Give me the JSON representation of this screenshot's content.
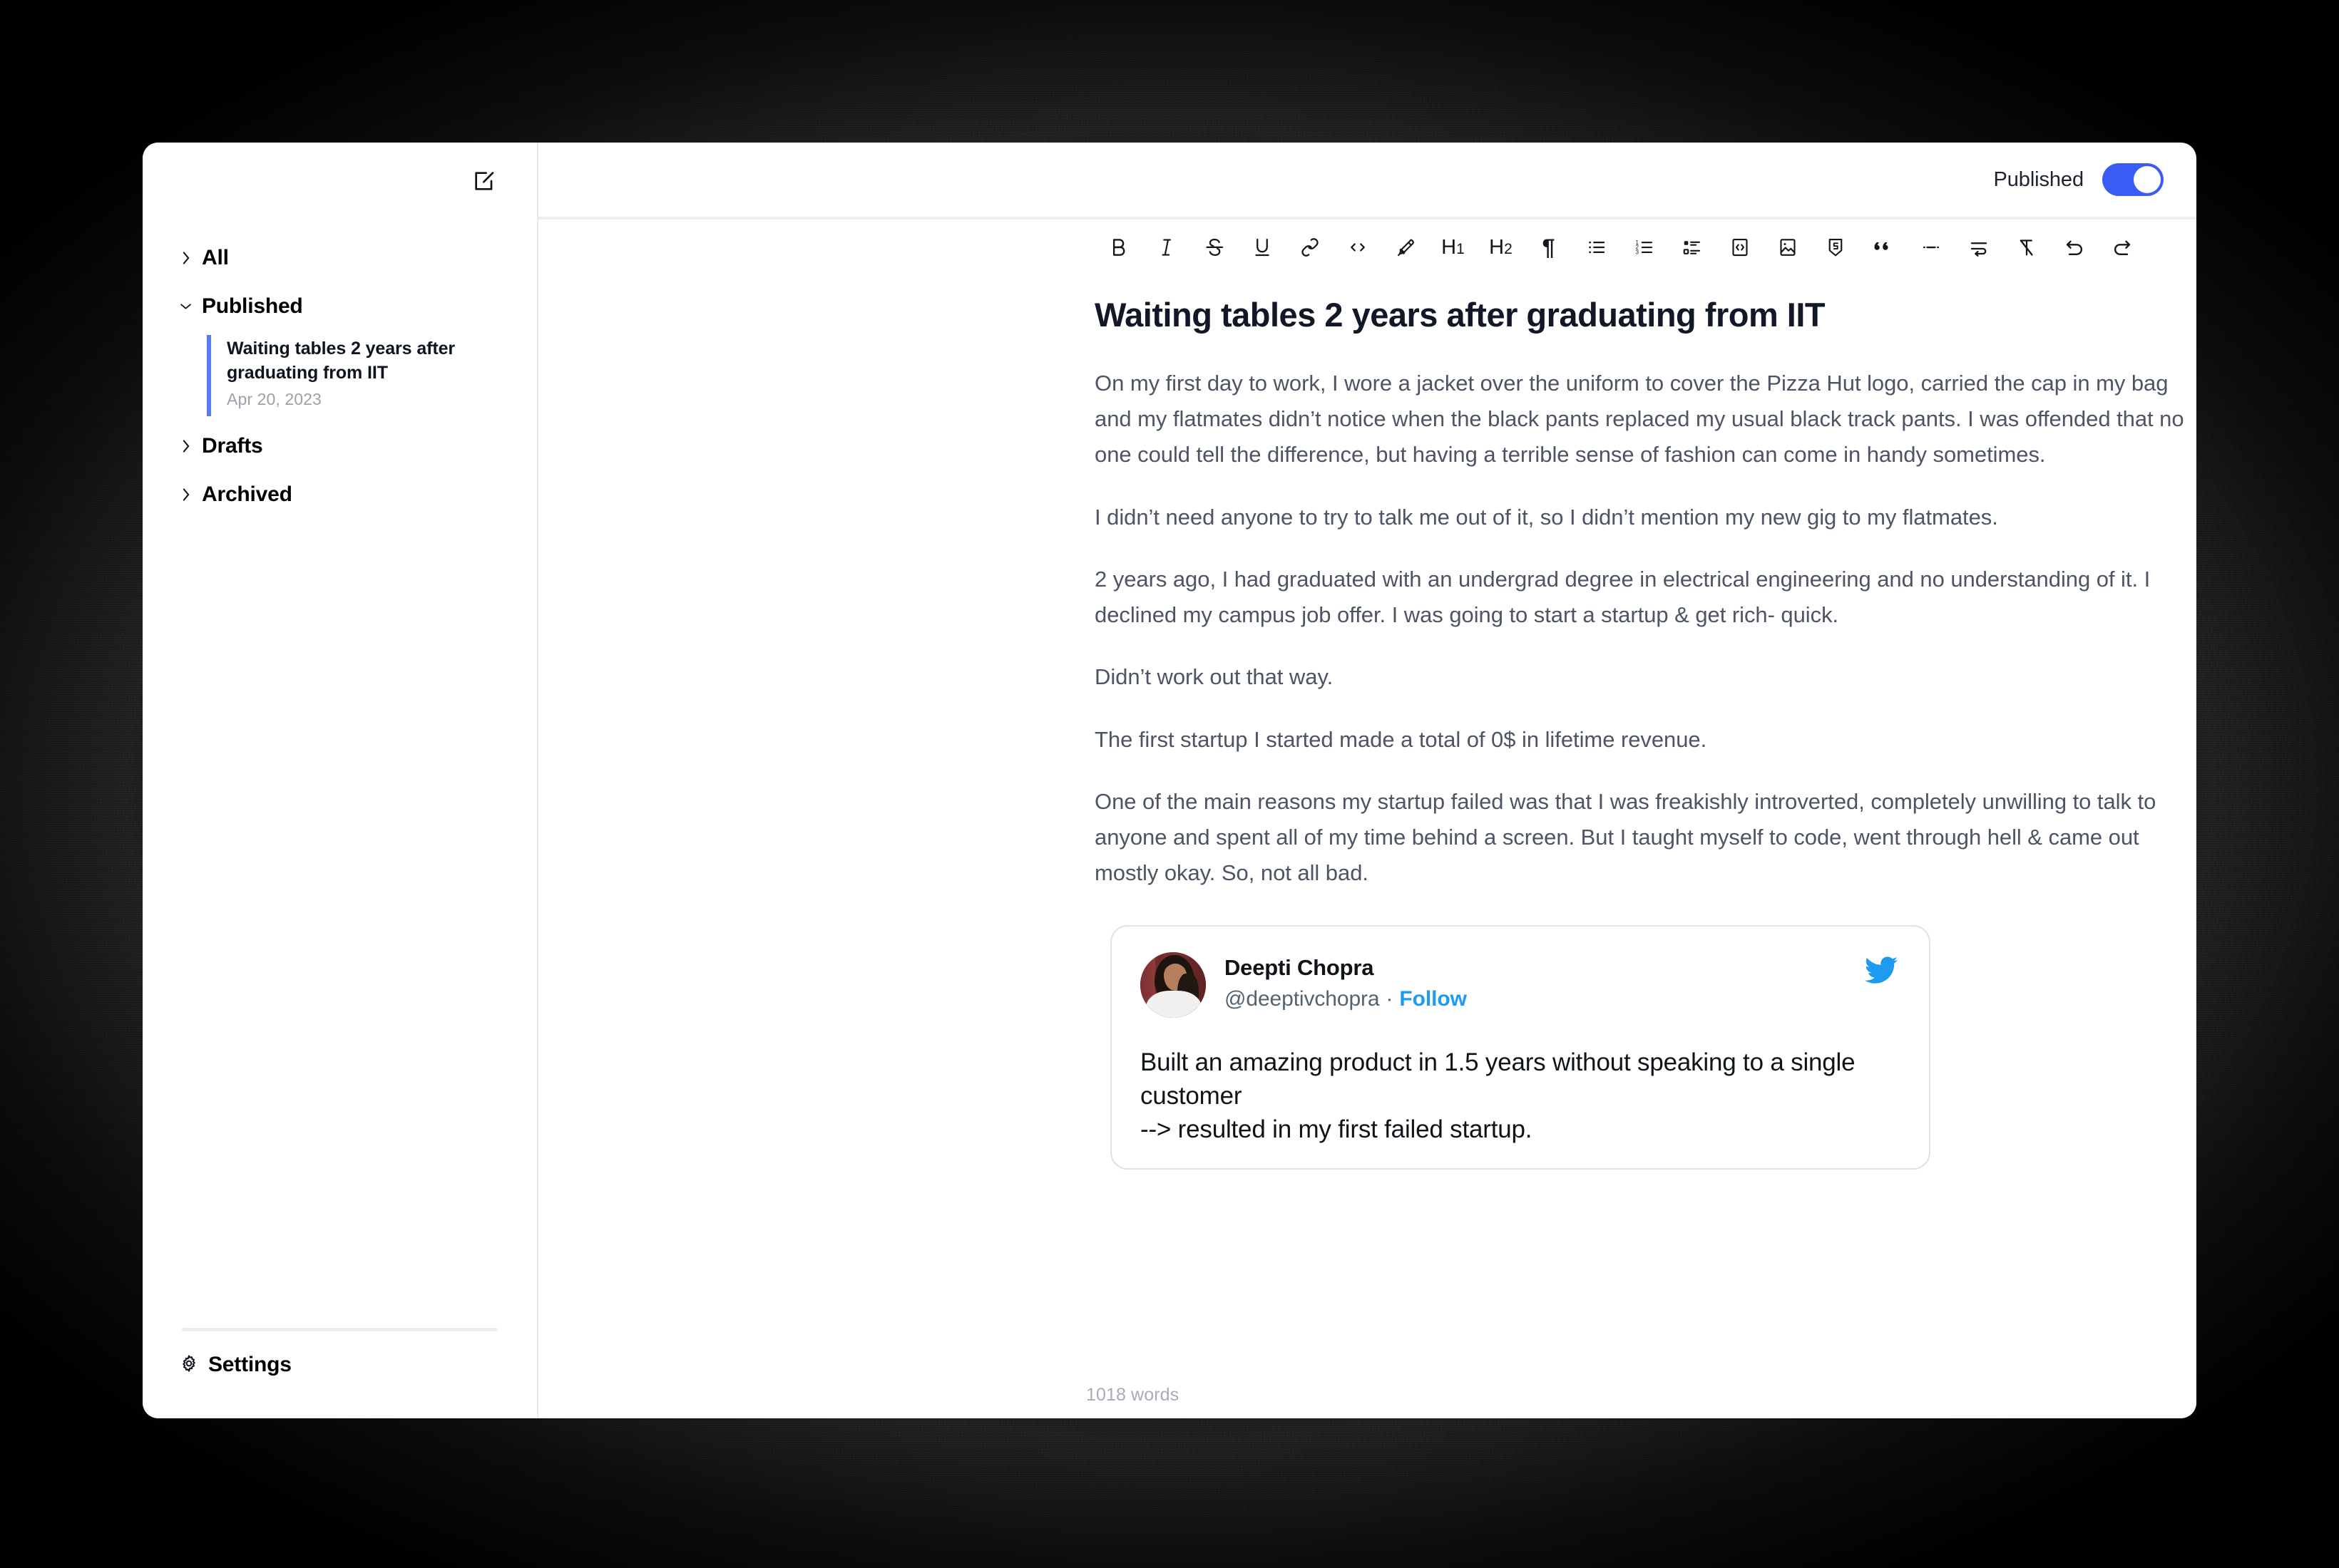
{
  "sidebar": {
    "compose_icon": "compose-note-icon",
    "groups": [
      {
        "label": "All",
        "icon": "chevron-right-icon",
        "expanded": false,
        "notes": []
      },
      {
        "label": "Published",
        "icon": "chevron-down-icon",
        "expanded": true,
        "notes": [
          {
            "title": "Waiting tables 2 years after graduating from IIT",
            "date": "Apr 20, 2023",
            "selected": true
          }
        ]
      },
      {
        "label": "Drafts",
        "icon": "chevron-right-icon",
        "expanded": false,
        "notes": []
      },
      {
        "label": "Archived",
        "icon": "chevron-right-icon",
        "expanded": false,
        "notes": []
      }
    ],
    "settings": {
      "label": "Settings",
      "icon": "gear-icon"
    }
  },
  "header": {
    "status_label": "Published",
    "toggle_on": true,
    "accent_color": "#3b5bf5"
  },
  "toolbar": {
    "items": [
      {
        "name": "bold",
        "icon": "bold-icon",
        "glyph": "B"
      },
      {
        "name": "italic",
        "icon": "italic-icon",
        "glyph": "I"
      },
      {
        "name": "strikethrough",
        "icon": "strikethrough-icon",
        "glyph": "S"
      },
      {
        "name": "underline",
        "icon": "underline-icon",
        "glyph": "U"
      },
      {
        "name": "link",
        "icon": "link-icon",
        "glyph": ""
      },
      {
        "name": "inline-code",
        "icon": "code-inline-icon",
        "glyph": ""
      },
      {
        "name": "highlight",
        "icon": "highlighter-icon",
        "glyph": ""
      },
      {
        "name": "heading-1",
        "icon": "h1-icon",
        "glyph": "H1"
      },
      {
        "name": "heading-2",
        "icon": "h2-icon",
        "glyph": "H2"
      },
      {
        "name": "paragraph",
        "icon": "pilcrow-icon",
        "glyph": "¶"
      },
      {
        "name": "bullet-list",
        "icon": "bullet-list-icon",
        "glyph": ""
      },
      {
        "name": "ordered-list",
        "icon": "ordered-list-icon",
        "glyph": ""
      },
      {
        "name": "task-list",
        "icon": "task-list-icon",
        "glyph": ""
      },
      {
        "name": "code-block",
        "icon": "code-block-icon",
        "glyph": ""
      },
      {
        "name": "image",
        "icon": "image-icon",
        "glyph": ""
      },
      {
        "name": "embed",
        "icon": "embed-badge-icon",
        "glyph": ""
      },
      {
        "name": "blockquote",
        "icon": "quote-icon",
        "glyph": ""
      },
      {
        "name": "horizontal-rule",
        "icon": "horizontal-rule-icon",
        "glyph": ""
      },
      {
        "name": "line-break",
        "icon": "line-break-icon",
        "glyph": ""
      },
      {
        "name": "clear-format",
        "icon": "clear-formatting-icon",
        "glyph": ""
      },
      {
        "name": "undo",
        "icon": "undo-icon",
        "glyph": ""
      },
      {
        "name": "redo",
        "icon": "redo-icon",
        "glyph": ""
      }
    ]
  },
  "document": {
    "title": "Waiting tables 2 years after graduating from IIT",
    "paragraphs": [
      "On my first day to work, I wore a jacket over the uniform to cover the Pizza Hut logo, carried the cap in my bag and my flatmates didn’t notice when the black pants replaced my usual black track pants. I was offended that no one could tell the difference, but having a terrible sense of fashion can come in handy sometimes.",
      "I didn’t need anyone to try to talk me out of it, so I didn’t mention my new gig to my flatmates.",
      "2 years ago, I had graduated with an undergrad degree in electrical engineering and no understanding of it. I declined my campus job offer. I was going to start a startup & get rich- quick.",
      "Didn’t work out that way.",
      "The first startup I started made a total of 0$ in lifetime revenue.",
      "One of the main reasons my startup failed was that I was freakishly introverted, completely unwilling to talk to anyone and spent all of my time behind a screen. But I taught myself to code, went through hell & came out mostly okay. So, not all bad."
    ],
    "tweet": {
      "author_name": "Deepti Chopra",
      "handle": "@deeptivchopra",
      "separator": "·",
      "follow_label": "Follow",
      "bird_icon": "twitter-bird-icon",
      "bird_color": "#1d9bf0",
      "text": "Built an amazing product in 1.5 years without speaking to a single customer\n--> resulted in my first failed startup."
    },
    "word_count": "1018 words"
  }
}
